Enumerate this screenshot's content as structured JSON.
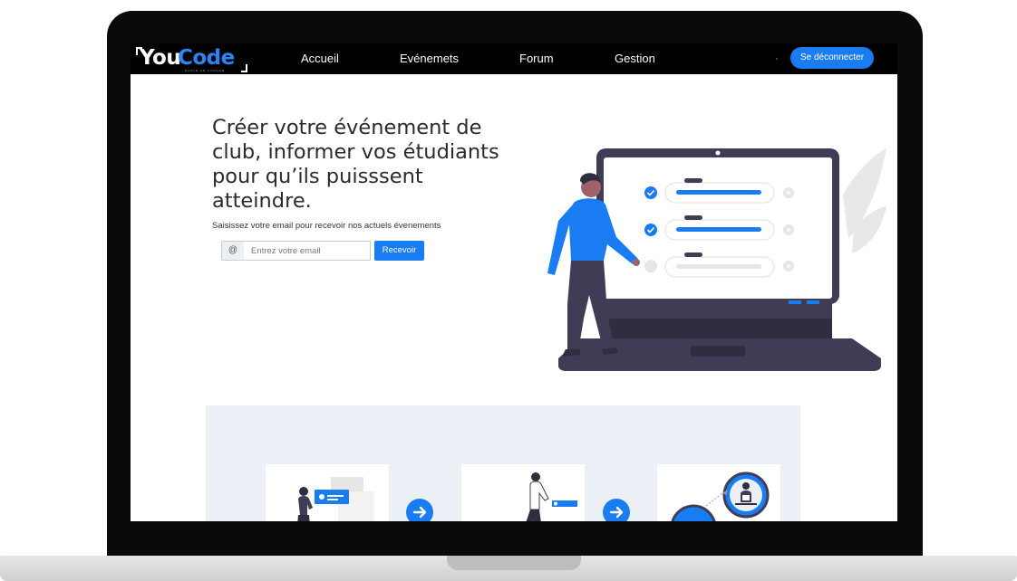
{
  "app": {
    "logo_you": "You",
    "logo_code": "Code",
    "logo_tagline": "ÉCOLE DE CODAGE"
  },
  "nav": {
    "items": [
      {
        "label": "Accueil"
      },
      {
        "label": "Evénemets"
      },
      {
        "label": "Forum"
      },
      {
        "label": "Gestion"
      }
    ],
    "logout_label": "Se déconnecter"
  },
  "hero": {
    "title": "Créer votre événement de club, informer vos étudiants pour qu’ils puisssent atteindre.",
    "subtitle": "Saisissez votre email pour recevoir nos actuels évenements",
    "email_prefix": "@",
    "email_placeholder": "Entrez votre email",
    "submit_label": "Recevoir"
  },
  "colors": {
    "accent": "#1a7cf2",
    "navbar": "#000000",
    "laptop_dark": "#3f3d56",
    "section_bg": "#eaf0f6"
  },
  "icons": {
    "checklist_check": "check-circle-icon",
    "step_arrow": "arrow-right-icon"
  }
}
